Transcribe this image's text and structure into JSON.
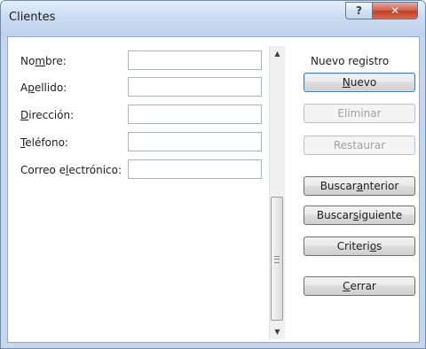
{
  "window": {
    "title": "Clientes",
    "help_glyph": "?",
    "close_glyph": "✕"
  },
  "form": {
    "fields": [
      {
        "label_pre": "No",
        "label_key": "m",
        "label_post": "bre:",
        "value": ""
      },
      {
        "label_pre": "A",
        "label_key": "p",
        "label_post": "ellido:",
        "value": ""
      },
      {
        "label_pre": "",
        "label_key": "D",
        "label_post": "irección:",
        "value": ""
      },
      {
        "label_pre": "",
        "label_key": "T",
        "label_post": "eléfono:",
        "value": ""
      },
      {
        "label_pre": "Correo e",
        "label_key": "l",
        "label_post": "ectrónico:",
        "value": ""
      }
    ]
  },
  "scrollbar": {
    "up_glyph": "▲",
    "down_glyph": "▼"
  },
  "actions": {
    "record_status": "Nuevo registro",
    "nuevo": {
      "pre": "",
      "key": "N",
      "post": "uevo"
    },
    "eliminar": {
      "label": "Eliminar"
    },
    "restaurar": {
      "label": "Restaurar"
    },
    "buscar_anterior": {
      "pre": "Buscar ",
      "key": "a",
      "post": "nterior"
    },
    "buscar_siguiente": {
      "pre": "Buscar ",
      "key": "s",
      "post": "iguiente"
    },
    "criterios": {
      "pre": "Criteri",
      "key": "o",
      "post": "s"
    },
    "cerrar": {
      "pre": "",
      "key": "C",
      "post": "errar"
    }
  },
  "colors": {
    "frame": "#c6d7ed",
    "close_red": "#c23b21",
    "default_button_border": "#3c7fb1",
    "disabled_text": "#a0a0a0"
  }
}
